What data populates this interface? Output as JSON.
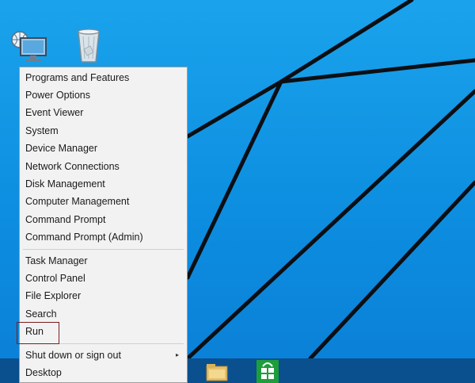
{
  "desktop": {
    "icons": [
      {
        "name": "network-icon"
      },
      {
        "name": "recycle-bin-icon"
      }
    ]
  },
  "menu": {
    "group1": [
      "Programs and Features",
      "Power Options",
      "Event Viewer",
      "System",
      "Device Manager",
      "Network Connections",
      "Disk Management",
      "Computer Management",
      "Command Prompt",
      "Command Prompt (Admin)"
    ],
    "group2": [
      "Task Manager",
      "Control Panel",
      "File Explorer",
      "Search",
      "Run"
    ],
    "group3": [
      "Shut down or sign out",
      "Desktop"
    ],
    "submenu_arrow": "▸"
  },
  "taskbar": {
    "icons": [
      "file-explorer-icon",
      "store-icon"
    ]
  },
  "colors": {
    "desktop_blue": "#1aa3ec",
    "taskbar": "#0a4f8e",
    "menu_bg": "#f2f2f2",
    "highlight_border": "#7a1d1d",
    "store_green": "#1e9e3a"
  }
}
